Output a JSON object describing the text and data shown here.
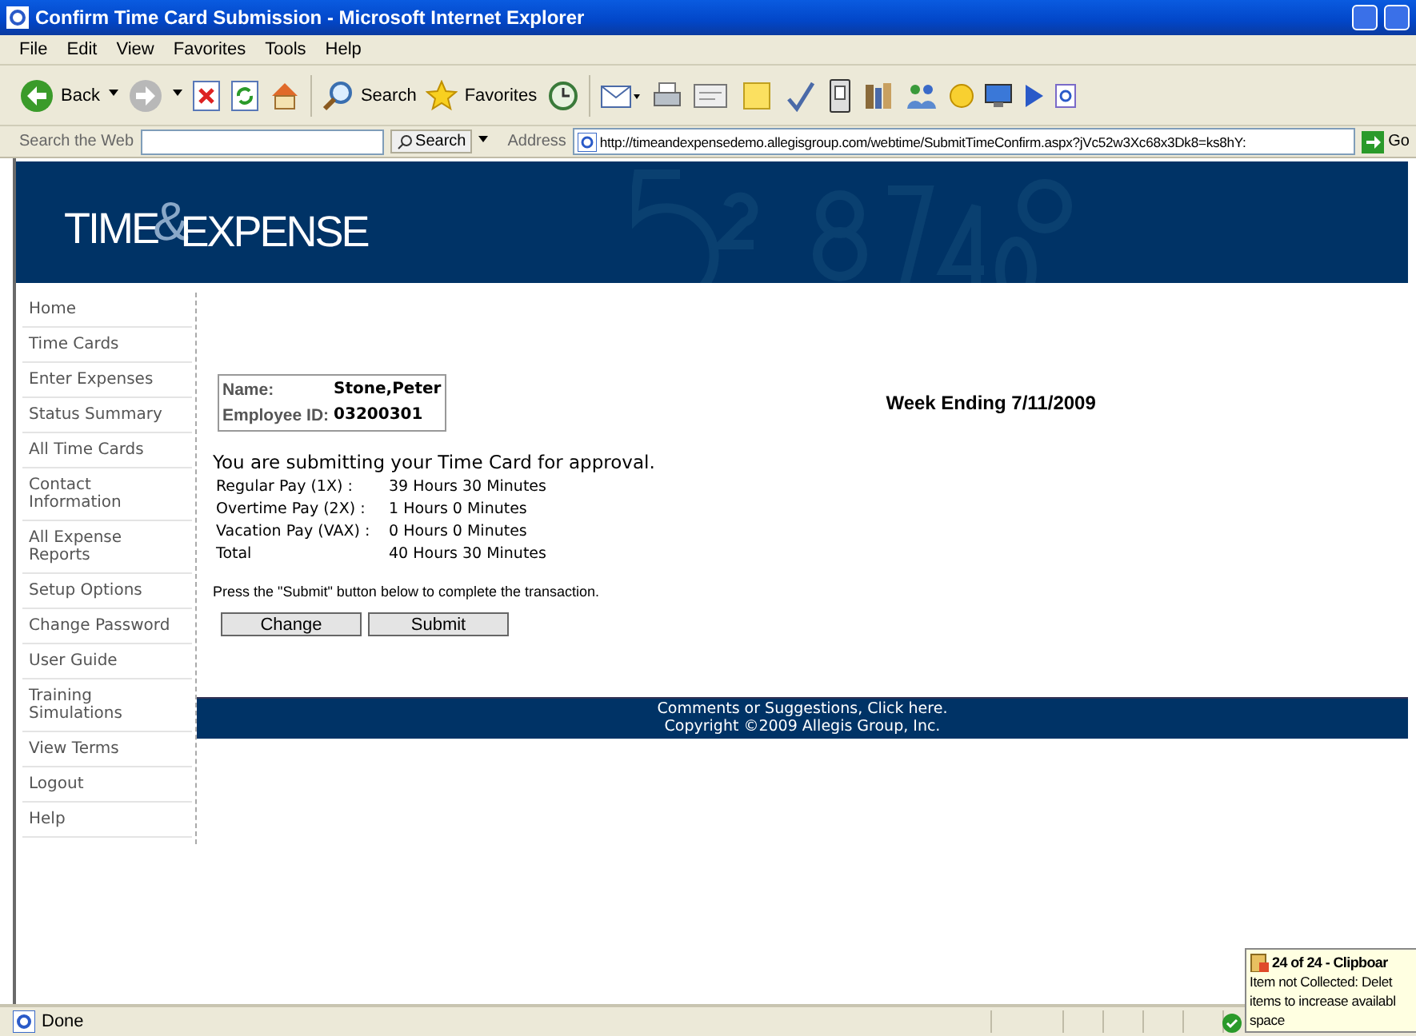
{
  "window": {
    "title": "Confirm Time Card Submission - Microsoft Internet Explorer"
  },
  "menu": [
    "File",
    "Edit",
    "View",
    "Favorites",
    "Tools",
    "Help"
  ],
  "toolbar": {
    "back": "Back",
    "search": "Search",
    "favorites": "Favorites"
  },
  "search_bar": {
    "label": "Search the Web",
    "button": "Search"
  },
  "address": {
    "label": "Address",
    "url": "http://timeandexpensedemo.allegisgroup.com/webtime/SubmitTimeConfirm.aspx?jVc52w3Xc68x3Dk8=ks8hY:",
    "go": "Go"
  },
  "banner": {
    "logo_left": "TIME",
    "logo_amp": "&",
    "logo_right": "EXPENSE"
  },
  "nav": [
    "Home",
    "Time Cards",
    "Enter Expenses",
    "Status Summary",
    "All Time Cards",
    "Contact Information",
    "All Expense Reports",
    "Setup Options",
    "Change Password",
    "User Guide",
    "Training Simulations",
    "View Terms",
    "Logout",
    "Help"
  ],
  "employee": {
    "name_label": "Name:",
    "name": "Stone,Peter",
    "id_label": "Employee ID:",
    "id": "03200301"
  },
  "week_ending": "Week Ending 7/11/2009",
  "intro": "You are submitting your Time Card for approval.",
  "pay_rows": [
    {
      "label": "Regular Pay (1X) :",
      "value": "39 Hours 30 Minutes"
    },
    {
      "label": "Overtime Pay (2X) :",
      "value": "1 Hours 0 Minutes"
    },
    {
      "label": "Vacation Pay (VAX) :",
      "value": "0 Hours 0 Minutes"
    },
    {
      "label": "Total",
      "value": "40 Hours 30 Minutes"
    }
  ],
  "instruction": "Press the \"Submit\" button below to complete the transaction.",
  "buttons": [
    "Change",
    "Submit"
  ],
  "footer": [
    "Comments or Suggestions, Click here.",
    "Copyright ©2009 Allegis Group, Inc."
  ],
  "status": {
    "text": "Done"
  },
  "clipboard_popup": {
    "title": "24 of 24 - Clipboar",
    "lines": [
      "Item not Collected: Delet",
      "items to increase availabl",
      "space"
    ]
  }
}
